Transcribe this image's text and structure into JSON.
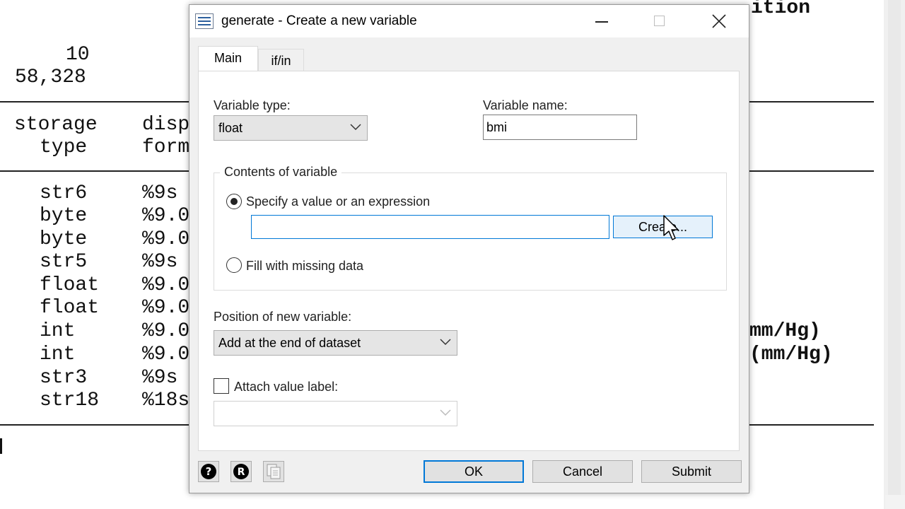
{
  "background": {
    "header_lines": [
      "10",
      "58,328"
    ],
    "top_right_text": "ition",
    "column_headers": {
      "storage": "storage",
      "type": "type",
      "disp": "disp",
      "form": "form"
    },
    "rows": [
      {
        "type": "str6",
        "fmt": "%9s"
      },
      {
        "type": "byte",
        "fmt": "%9.0"
      },
      {
        "type": "byte",
        "fmt": "%9.0"
      },
      {
        "type": "str5",
        "fmt": "%9s"
      },
      {
        "type": "float",
        "fmt": "%9.0"
      },
      {
        "type": "float",
        "fmt": "%9.0"
      },
      {
        "type": "int",
        "fmt": "%9.0"
      },
      {
        "type": "int",
        "fmt": "%9.0"
      },
      {
        "type": "str3",
        "fmt": "%9s"
      },
      {
        "type": "str18",
        "fmt": "%18s"
      }
    ],
    "right_labels": [
      "mm/Hg)",
      "(mm/Hg)"
    ]
  },
  "dialog": {
    "title": "generate - Create a new variable",
    "tabs": [
      {
        "label": "Main"
      },
      {
        "label": "if/in"
      }
    ],
    "variable_type": {
      "label": "Variable type:",
      "value": "float"
    },
    "variable_name": {
      "label": "Variable name:",
      "value": "bmi"
    },
    "contents_group": {
      "legend": "Contents of variable",
      "option_expression": "Specify a value or an expression",
      "expression_value": "",
      "create_button": "Create...",
      "option_missing": "Fill with missing data"
    },
    "position": {
      "label": "Position of new variable:",
      "value": "Add at the end of dataset"
    },
    "attach_value_label": {
      "label": "Attach value label:",
      "value": ""
    },
    "buttons": {
      "ok": "OK",
      "cancel": "Cancel",
      "submit": "Submit"
    },
    "icons": [
      "help-icon",
      "reset-icon",
      "copy-command-icon"
    ]
  },
  "colors": {
    "accent": "#0078d7",
    "dialog_bg": "#f0f0f0",
    "panel_bg": "#ffffff"
  }
}
